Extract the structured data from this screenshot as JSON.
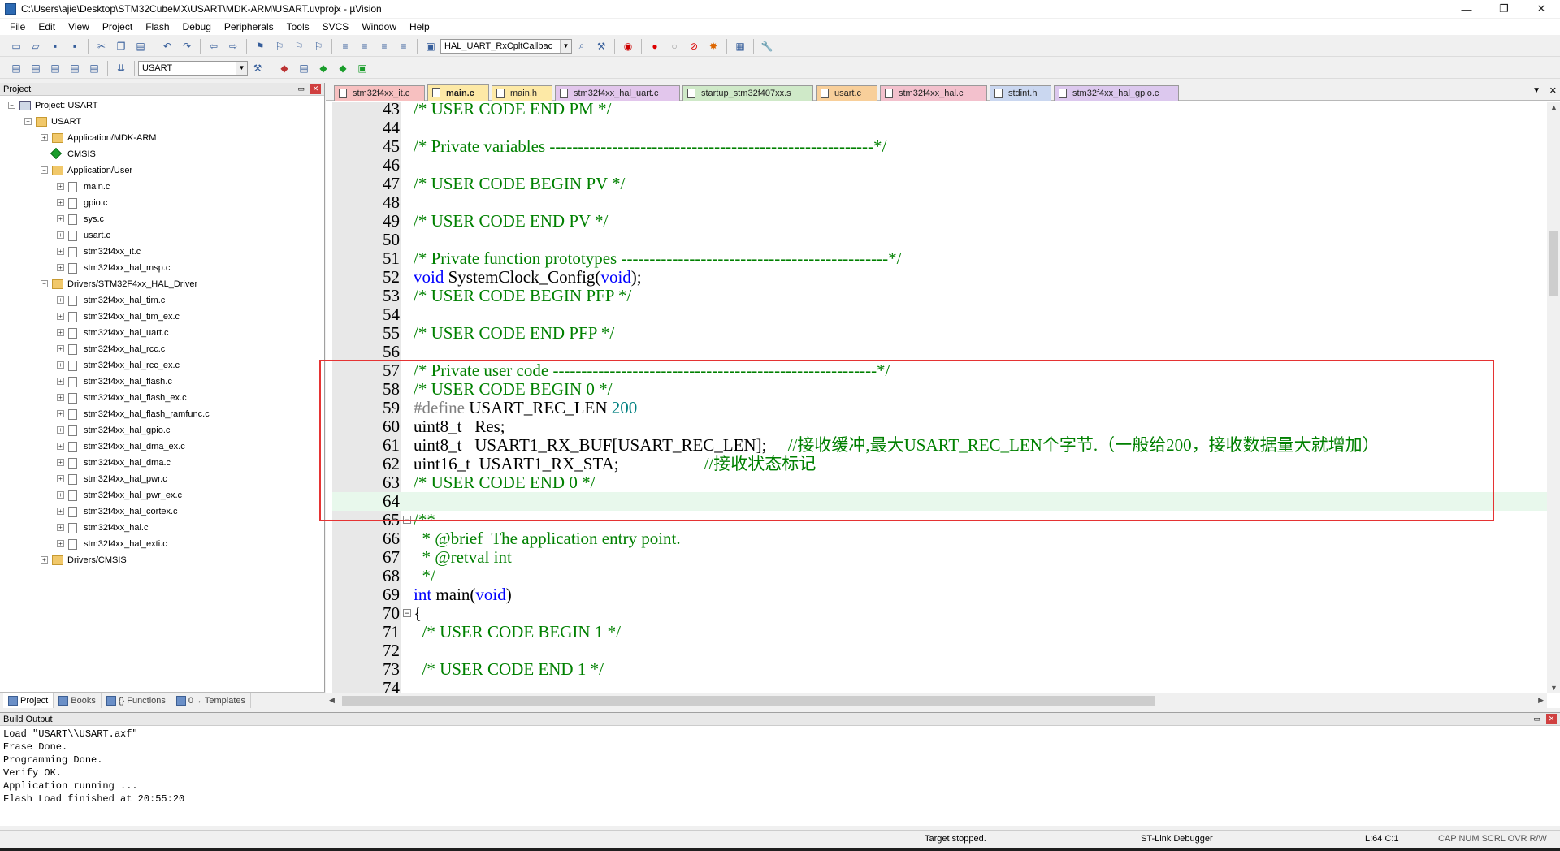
{
  "window": {
    "title": "C:\\Users\\ajie\\Desktop\\STM32CubeMX\\USART\\MDK-ARM\\USART.uvprojx - µVision",
    "minimize": "—",
    "maximize": "❐",
    "close": "✕"
  },
  "menu": [
    "File",
    "Edit",
    "View",
    "Project",
    "Flash",
    "Debug",
    "Peripherals",
    "Tools",
    "SVCS",
    "Window",
    "Help"
  ],
  "toolbar1": {
    "function_combo": "HAL_UART_RxCpltCallbac"
  },
  "toolbar2": {
    "target_combo": "USART"
  },
  "project_panel": {
    "header": "Project",
    "tree": [
      {
        "level": 0,
        "label": "Project: USART",
        "type": "project",
        "expander": "−"
      },
      {
        "level": 1,
        "label": "USART",
        "type": "folder",
        "expander": "−"
      },
      {
        "level": 2,
        "label": "Application/MDK-ARM",
        "type": "folder",
        "expander": "+"
      },
      {
        "level": 2,
        "label": "CMSIS",
        "type": "gem",
        "expander": ""
      },
      {
        "level": 2,
        "label": "Application/User",
        "type": "folder",
        "expander": "−"
      },
      {
        "level": 3,
        "label": "main.c",
        "type": "file",
        "expander": "+"
      },
      {
        "level": 3,
        "label": "gpio.c",
        "type": "file",
        "expander": "+"
      },
      {
        "level": 3,
        "label": "sys.c",
        "type": "file",
        "expander": "+"
      },
      {
        "level": 3,
        "label": "usart.c",
        "type": "file",
        "expander": "+"
      },
      {
        "level": 3,
        "label": "stm32f4xx_it.c",
        "type": "file",
        "expander": "+"
      },
      {
        "level": 3,
        "label": "stm32f4xx_hal_msp.c",
        "type": "file",
        "expander": "+"
      },
      {
        "level": 2,
        "label": "Drivers/STM32F4xx_HAL_Driver",
        "type": "folder",
        "expander": "−"
      },
      {
        "level": 3,
        "label": "stm32f4xx_hal_tim.c",
        "type": "file",
        "expander": "+"
      },
      {
        "level": 3,
        "label": "stm32f4xx_hal_tim_ex.c",
        "type": "file",
        "expander": "+"
      },
      {
        "level": 3,
        "label": "stm32f4xx_hal_uart.c",
        "type": "file",
        "expander": "+"
      },
      {
        "level": 3,
        "label": "stm32f4xx_hal_rcc.c",
        "type": "file",
        "expander": "+"
      },
      {
        "level": 3,
        "label": "stm32f4xx_hal_rcc_ex.c",
        "type": "file",
        "expander": "+"
      },
      {
        "level": 3,
        "label": "stm32f4xx_hal_flash.c",
        "type": "file",
        "expander": "+"
      },
      {
        "level": 3,
        "label": "stm32f4xx_hal_flash_ex.c",
        "type": "file",
        "expander": "+"
      },
      {
        "level": 3,
        "label": "stm32f4xx_hal_flash_ramfunc.c",
        "type": "file",
        "expander": "+"
      },
      {
        "level": 3,
        "label": "stm32f4xx_hal_gpio.c",
        "type": "file",
        "expander": "+"
      },
      {
        "level": 3,
        "label": "stm32f4xx_hal_dma_ex.c",
        "type": "file",
        "expander": "+"
      },
      {
        "level": 3,
        "label": "stm32f4xx_hal_dma.c",
        "type": "file",
        "expander": "+"
      },
      {
        "level": 3,
        "label": "stm32f4xx_hal_pwr.c",
        "type": "file",
        "expander": "+"
      },
      {
        "level": 3,
        "label": "stm32f4xx_hal_pwr_ex.c",
        "type": "file",
        "expander": "+"
      },
      {
        "level": 3,
        "label": "stm32f4xx_hal_cortex.c",
        "type": "file",
        "expander": "+"
      },
      {
        "level": 3,
        "label": "stm32f4xx_hal.c",
        "type": "file",
        "expander": "+"
      },
      {
        "level": 3,
        "label": "stm32f4xx_hal_exti.c",
        "type": "file",
        "expander": "+"
      },
      {
        "level": 2,
        "label": "Drivers/CMSIS",
        "type": "folder",
        "expander": "+"
      }
    ],
    "bottom_tabs": [
      "Project",
      "Books",
      "{} Functions",
      "0→ Templates"
    ]
  },
  "editor": {
    "tabs": [
      {
        "label": "stm32f4xx_it.c",
        "color": "#f7c0c0",
        "active": false
      },
      {
        "label": "main.c",
        "color": "#fde9a6",
        "active": true
      },
      {
        "label": "main.h",
        "color": "#fde9a6",
        "active": false
      },
      {
        "label": "stm32f4xx_hal_uart.c",
        "color": "#e2c6ec",
        "active": false
      },
      {
        "label": "startup_stm32f407xx.s",
        "color": "#cfe9c8",
        "active": false
      },
      {
        "label": "usart.c",
        "color": "#f8cf9a",
        "active": false
      },
      {
        "label": "stm32f4xx_hal.c",
        "color": "#f3c1cd",
        "active": false
      },
      {
        "label": "stdint.h",
        "color": "#cad7f0",
        "active": false
      },
      {
        "label": "stm32f4xx_hal_gpio.c",
        "color": "#dcc8ee",
        "active": false
      }
    ],
    "lines": [
      {
        "n": "43",
        "parts": [
          [
            "com",
            "/* USER CODE END PM */"
          ]
        ]
      },
      {
        "n": "44",
        "parts": []
      },
      {
        "n": "45",
        "parts": [
          [
            "com",
            "/* Private variables ---------------------------------------------------------*/"
          ]
        ]
      },
      {
        "n": "46",
        "parts": []
      },
      {
        "n": "47",
        "parts": [
          [
            "com",
            "/* USER CODE BEGIN PV */"
          ]
        ]
      },
      {
        "n": "48",
        "parts": []
      },
      {
        "n": "49",
        "parts": [
          [
            "com",
            "/* USER CODE END PV */"
          ]
        ]
      },
      {
        "n": "50",
        "parts": []
      },
      {
        "n": "51",
        "parts": [
          [
            "com",
            "/* Private function prototypes -----------------------------------------------*/"
          ]
        ]
      },
      {
        "n": "52",
        "parts": [
          [
            "key",
            "void"
          ],
          [
            "txt",
            " SystemClock_Config("
          ],
          [
            "key",
            "void"
          ],
          [
            "txt",
            ");"
          ]
        ]
      },
      {
        "n": "53",
        "parts": [
          [
            "com",
            "/* USER CODE BEGIN PFP */"
          ]
        ]
      },
      {
        "n": "54",
        "parts": []
      },
      {
        "n": "55",
        "parts": [
          [
            "com",
            "/* USER CODE END PFP */"
          ]
        ]
      },
      {
        "n": "56",
        "parts": []
      },
      {
        "n": "57",
        "parts": [
          [
            "com",
            "/* Private user code ---------------------------------------------------------*/"
          ]
        ]
      },
      {
        "n": "58",
        "parts": [
          [
            "com",
            "/* USER CODE BEGIN 0 */"
          ]
        ]
      },
      {
        "n": "59",
        "parts": [
          [
            "pp",
            "#define"
          ],
          [
            "txt",
            " USART_REC_LEN "
          ],
          [
            "num",
            "200"
          ]
        ]
      },
      {
        "n": "60",
        "parts": [
          [
            "txt",
            "uint8_t   Res;"
          ]
        ]
      },
      {
        "n": "61",
        "parts": [
          [
            "txt",
            "uint8_t   USART1_RX_BUF[USART_REC_LEN];     "
          ],
          [
            "com",
            "//接收缓冲,最大USART_REC_LEN个字节.（一般给200，接收数据量大就增加）"
          ]
        ]
      },
      {
        "n": "62",
        "parts": [
          [
            "txt",
            "uint16_t  USART1_RX_STA;                    "
          ],
          [
            "com",
            "//接收状态标记"
          ]
        ]
      },
      {
        "n": "63",
        "parts": [
          [
            "com",
            "/* USER CODE END 0 */"
          ]
        ]
      },
      {
        "n": "64",
        "parts": [],
        "highlight": true
      },
      {
        "n": "65",
        "parts": [
          [
            "com",
            "/**"
          ]
        ],
        "fold": "−"
      },
      {
        "n": "66",
        "parts": [
          [
            "com",
            "  * @brief  The application entry point."
          ]
        ]
      },
      {
        "n": "67",
        "parts": [
          [
            "com",
            "  * @retval int"
          ]
        ]
      },
      {
        "n": "68",
        "parts": [
          [
            "com",
            "  */"
          ]
        ]
      },
      {
        "n": "69",
        "parts": [
          [
            "key",
            "int"
          ],
          [
            "txt",
            " main("
          ],
          [
            "key",
            "void"
          ],
          [
            "txt",
            ")"
          ]
        ]
      },
      {
        "n": "70",
        "parts": [
          [
            "txt",
            "{"
          ]
        ],
        "fold": "−"
      },
      {
        "n": "71",
        "parts": [
          [
            "com",
            "  /* USER CODE BEGIN 1 */"
          ]
        ]
      },
      {
        "n": "72",
        "parts": []
      },
      {
        "n": "73",
        "parts": [
          [
            "com",
            "  /* USER CODE END 1 */"
          ]
        ]
      },
      {
        "n": "74",
        "parts": []
      }
    ]
  },
  "build_output": {
    "header": "Build Output",
    "lines": [
      "Load \"USART\\\\USART.axf\"",
      "Erase Done.",
      "Programming Done.",
      "Verify OK.",
      "Application running ...",
      "Flash Load finished at 20:55:20"
    ]
  },
  "status": {
    "target": "Target stopped.",
    "debugger": "ST-Link Debugger",
    "position": "L:64 C:1",
    "indicators": "CAP  NUM  SCRL  OVR  R/W"
  }
}
